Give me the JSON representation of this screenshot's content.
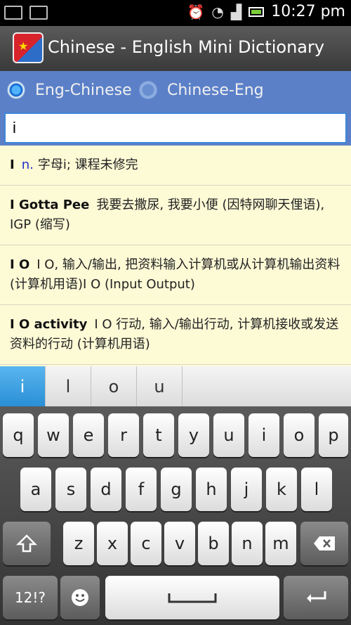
{
  "status": {
    "time": "10:27 pm"
  },
  "app": {
    "title": "Chinese - English Mini Dictionary"
  },
  "mode": {
    "option1": "Eng-Chinese",
    "option2": "Chinese-Eng"
  },
  "search": {
    "value": "i"
  },
  "results": [
    {
      "term": "I",
      "pos": "n.",
      "definition": "字母i; 课程未修完"
    },
    {
      "term": "I Gotta Pee",
      "definition": "我要去撒尿, 我要小便 (因特网聊天俚语), IGP (缩写)"
    },
    {
      "term": "I O",
      "definition": "I O, 输入/输出, 把资料输入计算机或从计算机输出资料 (计算机用语)I O (Input Output)"
    },
    {
      "term": "I O activity",
      "definition": "I O 行动, 输入/输出行动, 计算机接收或发送资料的行动 (计算机用语)"
    }
  ],
  "suggestions": [
    "i",
    "l",
    "o",
    "u"
  ],
  "keyboard": {
    "row1": [
      "q",
      "w",
      "e",
      "r",
      "t",
      "y",
      "u",
      "i",
      "o",
      "p"
    ],
    "row2": [
      "a",
      "s",
      "d",
      "f",
      "g",
      "h",
      "j",
      "k",
      "l"
    ],
    "row3": [
      "z",
      "x",
      "c",
      "v",
      "b",
      "n",
      "m"
    ],
    "symbols_label": "12!?"
  }
}
